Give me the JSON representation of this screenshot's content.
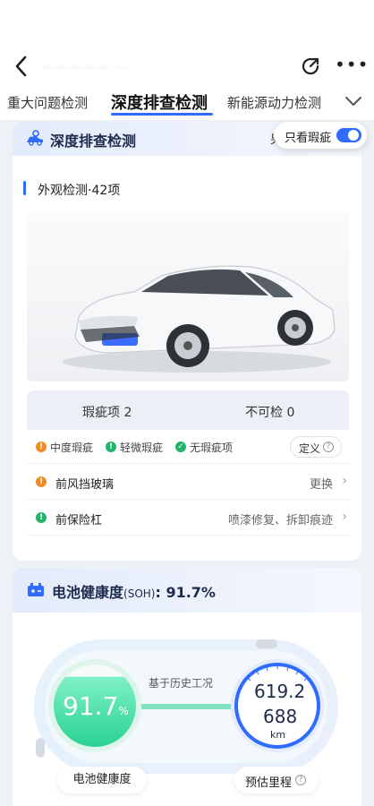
{
  "nav": {
    "title": "……………  …"
  },
  "tabs": [
    {
      "label": "重大问题检测"
    },
    {
      "label": "深度排查检测"
    },
    {
      "label": "新能源动力检测"
    }
  ],
  "card1": {
    "title": "深度排查检测",
    "right_text": "另",
    "toggle_label": "只看瑕疵",
    "toggle_on": true,
    "section_title": "外观检测·42项",
    "stats": [
      {
        "label": "瑕疵项 2"
      },
      {
        "label": "不可检 0"
      }
    ],
    "legend": [
      {
        "label": "中度瑕疵",
        "color": "#f08a24",
        "icon": "exclamation-icon"
      },
      {
        "label": "轻微瑕疵",
        "color": "#1fb36b",
        "icon": "exclamation-icon"
      },
      {
        "label": "无瑕疵项",
        "color": "#1fb36b",
        "icon": "check-icon"
      }
    ],
    "define_label": "定义",
    "items": [
      {
        "name": "前风挡玻璃",
        "value": "更换",
        "color": "#f08a24"
      },
      {
        "name": "前保险杠",
        "value": "喷漆修复、拆卸痕迹",
        "color": "#1fb36b"
      }
    ]
  },
  "card2": {
    "title": "电池健康度",
    "title_suffix": "(SOH)",
    "title_value": ": 91.7%",
    "history_label": "基于历史工况",
    "soh_value": "91.7",
    "soh_unit": "%",
    "soh_fraction": 0.917,
    "range_top": "619.2",
    "range_bottom": "688",
    "range_unit": "km",
    "soh_label": "电池健康度",
    "range_label": "预估里程"
  },
  "colors": {
    "accent": "#2f6bff",
    "green": "#2fd49b",
    "orange": "#f08a24"
  }
}
